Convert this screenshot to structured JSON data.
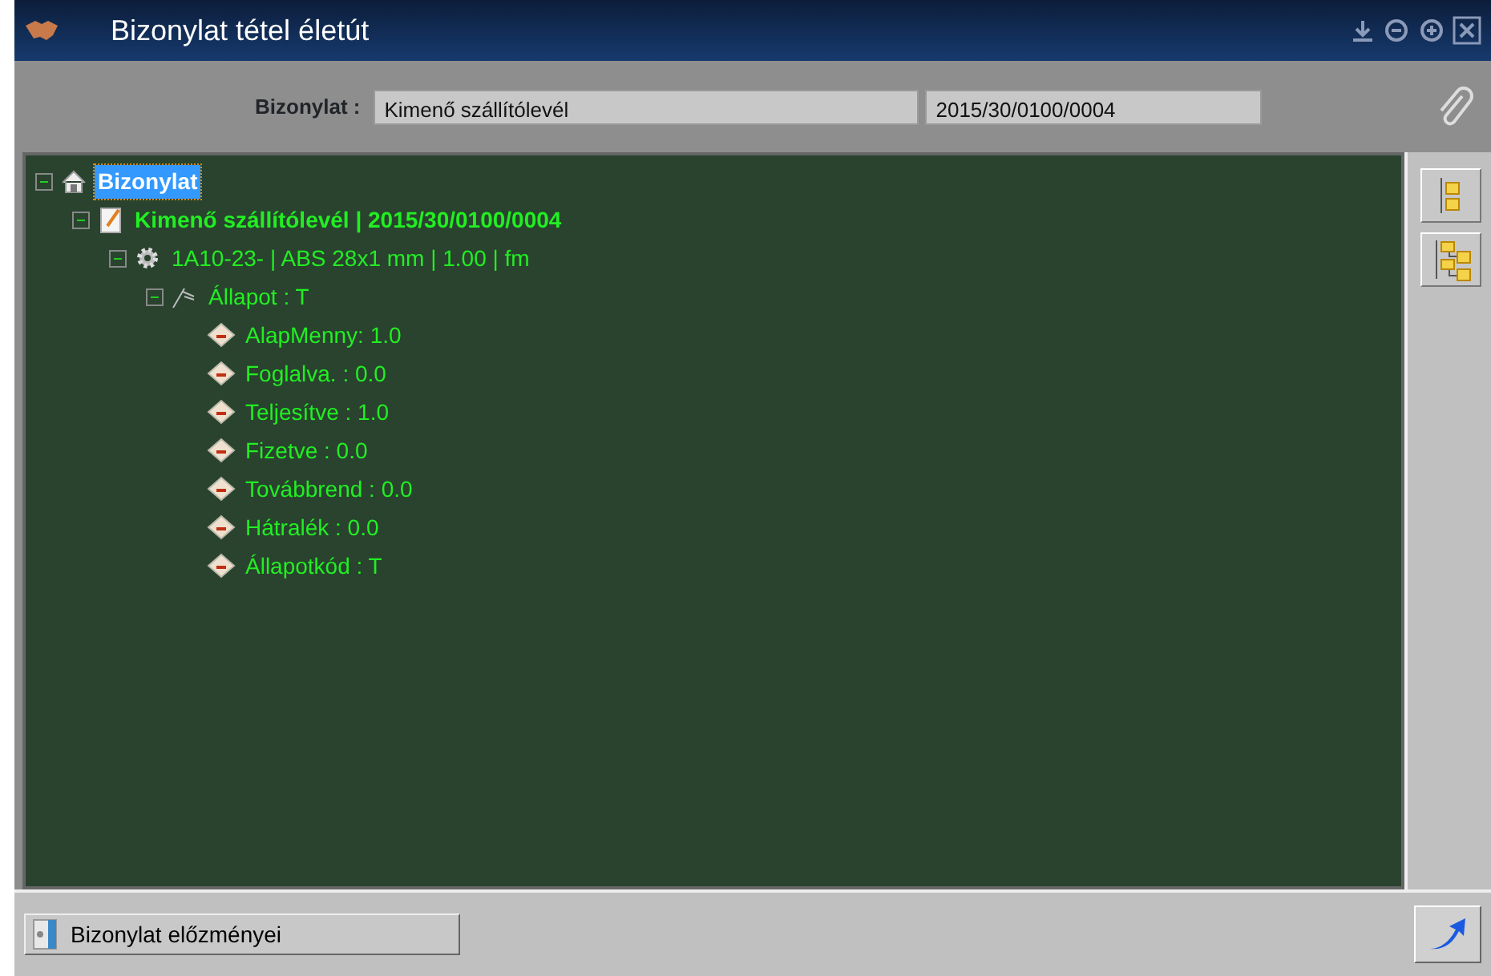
{
  "window": {
    "title": "Bizonylat tétel életút"
  },
  "header": {
    "label": "Bizonylat :",
    "type_value": "Kimenő szállítólevél",
    "number_value": "2015/30/0100/0004"
  },
  "tree": [
    {
      "kind": "root",
      "label": "Bizonylat",
      "selected": true,
      "expanded": true,
      "children": [
        {
          "kind": "document",
          "label": "Kimenő szállítólevél | 2015/30/0100/0004",
          "selected": false,
          "expanded": true,
          "children": [
            {
              "kind": "item",
              "label": "1A10-23- | ABS 28x1 mm | 1.00 | fm",
              "selected": false,
              "expanded": true,
              "children": [
                {
                  "kind": "status",
                  "label": "Állapot : T",
                  "selected": false,
                  "expanded": true,
                  "children": [
                    {
                      "kind": "field",
                      "label": "AlapMenny: 1.0",
                      "selected": false
                    },
                    {
                      "kind": "field",
                      "label": "Foglalva. : 0.0",
                      "selected": false
                    },
                    {
                      "kind": "field",
                      "label": "Teljesítve : 1.0",
                      "selected": false
                    },
                    {
                      "kind": "field",
                      "label": "Fizetve : 0.0",
                      "selected": false
                    },
                    {
                      "kind": "field",
                      "label": "Továbbrend : 0.0",
                      "selected": false
                    },
                    {
                      "kind": "field",
                      "label": "Hátralék : 0.0",
                      "selected": false
                    },
                    {
                      "kind": "field",
                      "label": "Állapotkód : T",
                      "selected": false
                    }
                  ]
                }
              ]
            }
          ]
        }
      ]
    }
  ],
  "footer": {
    "history_button": "Bizonylat előzményei"
  }
}
